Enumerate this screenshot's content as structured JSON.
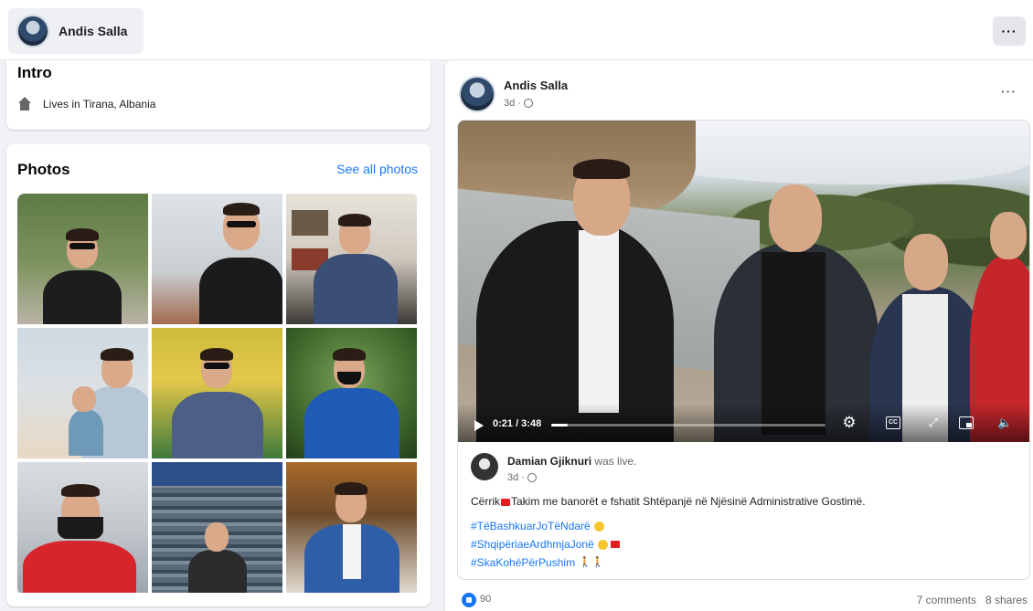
{
  "header": {
    "profile_name": "Andis Salla",
    "more_label": "···"
  },
  "intro": {
    "title": "Intro",
    "lives_in": "Lives in Tirana, Albania"
  },
  "photos": {
    "title": "Photos",
    "see_all": "See all photos"
  },
  "post": {
    "author": "Andis Salla",
    "time": "3d ·",
    "more_label": "···",
    "video": {
      "time": "0:21 / 3:48",
      "progress": 0.06
    },
    "shared": {
      "author": "Damian Gjiknuri",
      "action": " was live.",
      "time": "3d ·",
      "text_place": "Cërrik",
      "text_body": "Takim me banorët e fshatit Shtëpanjë në Njësinë Administrative Gostimë.",
      "hashtags": [
        "#TëBashkuarJoTëNdarë",
        "#ShqipëriaeArdhmjaJonë",
        "#SkaKohëPërPushim"
      ]
    },
    "reactions_count": "90",
    "comments": "7 comments",
    "shares": "8 shares"
  },
  "colors": {
    "accent": "#1877f2",
    "background": "#f0f2f5",
    "flag": "#e41e20"
  }
}
